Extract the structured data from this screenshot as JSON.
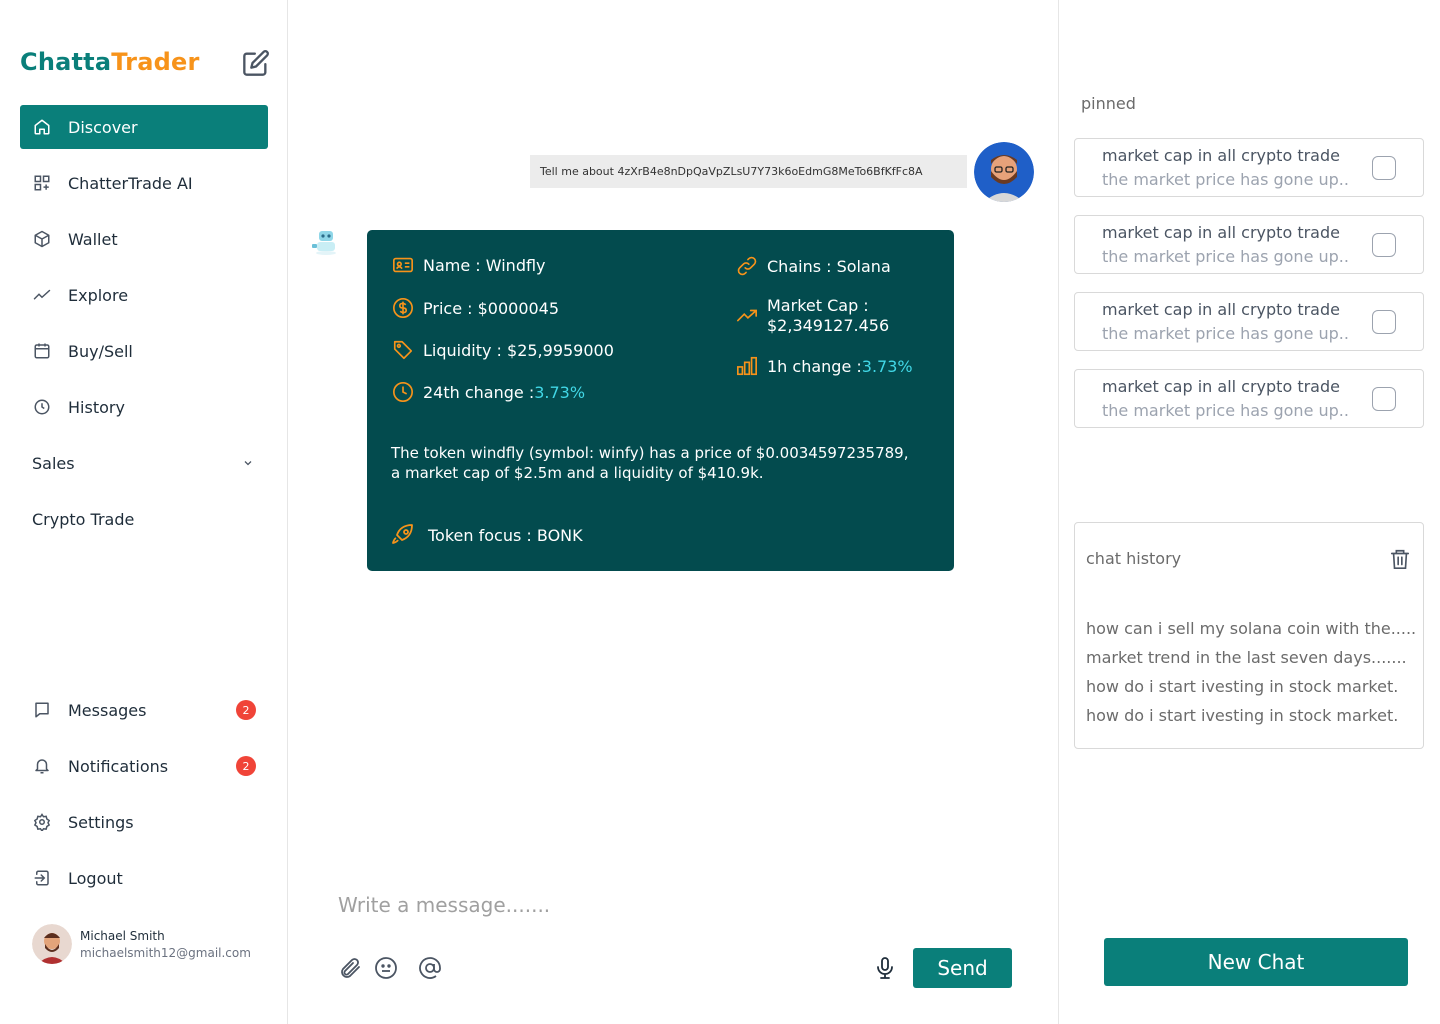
{
  "brand": {
    "part1": "Chatta",
    "part2": "Trader"
  },
  "nav": {
    "items": [
      {
        "label": "Discover",
        "icon": "home-icon",
        "active": true
      },
      {
        "label": "ChatterTrade AI",
        "icon": "grid-plus-icon"
      },
      {
        "label": "Wallet",
        "icon": "box-icon"
      },
      {
        "label": "Explore",
        "icon": "trend-icon"
      },
      {
        "label": "Buy/Sell",
        "icon": "calendar-icon"
      },
      {
        "label": "History",
        "icon": "clock-icon"
      }
    ],
    "sales_label": "Sales",
    "crypto_label": "Crypto Trade",
    "bottom": [
      {
        "label": "Messages",
        "icon": "message-icon",
        "badge": "2"
      },
      {
        "label": "Notifications",
        "icon": "bell-icon",
        "badge": "2"
      },
      {
        "label": "Settings",
        "icon": "gear-icon"
      },
      {
        "label": "Logout",
        "icon": "logout-icon"
      }
    ]
  },
  "profile": {
    "name": "Michael Smith",
    "email": "michaelsmith12@gmail.com"
  },
  "chat": {
    "user_message": "Tell me about 4zXrB4e8nDpQaVpZLsU7Y73k6oEdmG8MeTo6BfKfFc8A",
    "card": {
      "name": "Name : Windfly",
      "price": "Price : $0000045",
      "liquidity": "Liquidity : $25,9959000",
      "change24_label": "24th change : ",
      "change24_value": "3.73%",
      "chains": "Chains : Solana",
      "market_cap_label": "Market Cap :",
      "market_cap_value": "$2,349127.456",
      "change1h_label": "1h change : ",
      "change1h_value": "3.73%",
      "description": "The token windfly (symbol: winfy) has a price of $0.0034597235789, a market cap of $2.5m and a liquidity of $410.9k.",
      "token_focus": "Token focus : BONK"
    },
    "composer": {
      "placeholder": "Write a message.......",
      "send_label": "Send"
    }
  },
  "right": {
    "pinned_title": "pinned",
    "pinned": [
      {
        "title": "market cap in all crypto trade",
        "subtitle": "the market price has gone up.."
      },
      {
        "title": "market cap in all crypto trade",
        "subtitle": "the market price has gone up.."
      },
      {
        "title": "market cap in all crypto trade",
        "subtitle": "the market price has gone up.."
      },
      {
        "title": "market cap in all crypto trade",
        "subtitle": "the market price has gone up.."
      }
    ],
    "history_title": "chat history",
    "history": [
      "how can i sell my solana coin with the.....",
      "market trend in the last seven days.......",
      "how do i start ivesting in stock market.",
      "how do i start ivesting in stock market."
    ],
    "new_chat_label": "New Chat"
  },
  "colors": {
    "primary": "#0a7f7a",
    "accent": "#f7931a",
    "card_bg": "#034b4e",
    "highlight": "#41d7e6",
    "badge": "#f04438"
  }
}
